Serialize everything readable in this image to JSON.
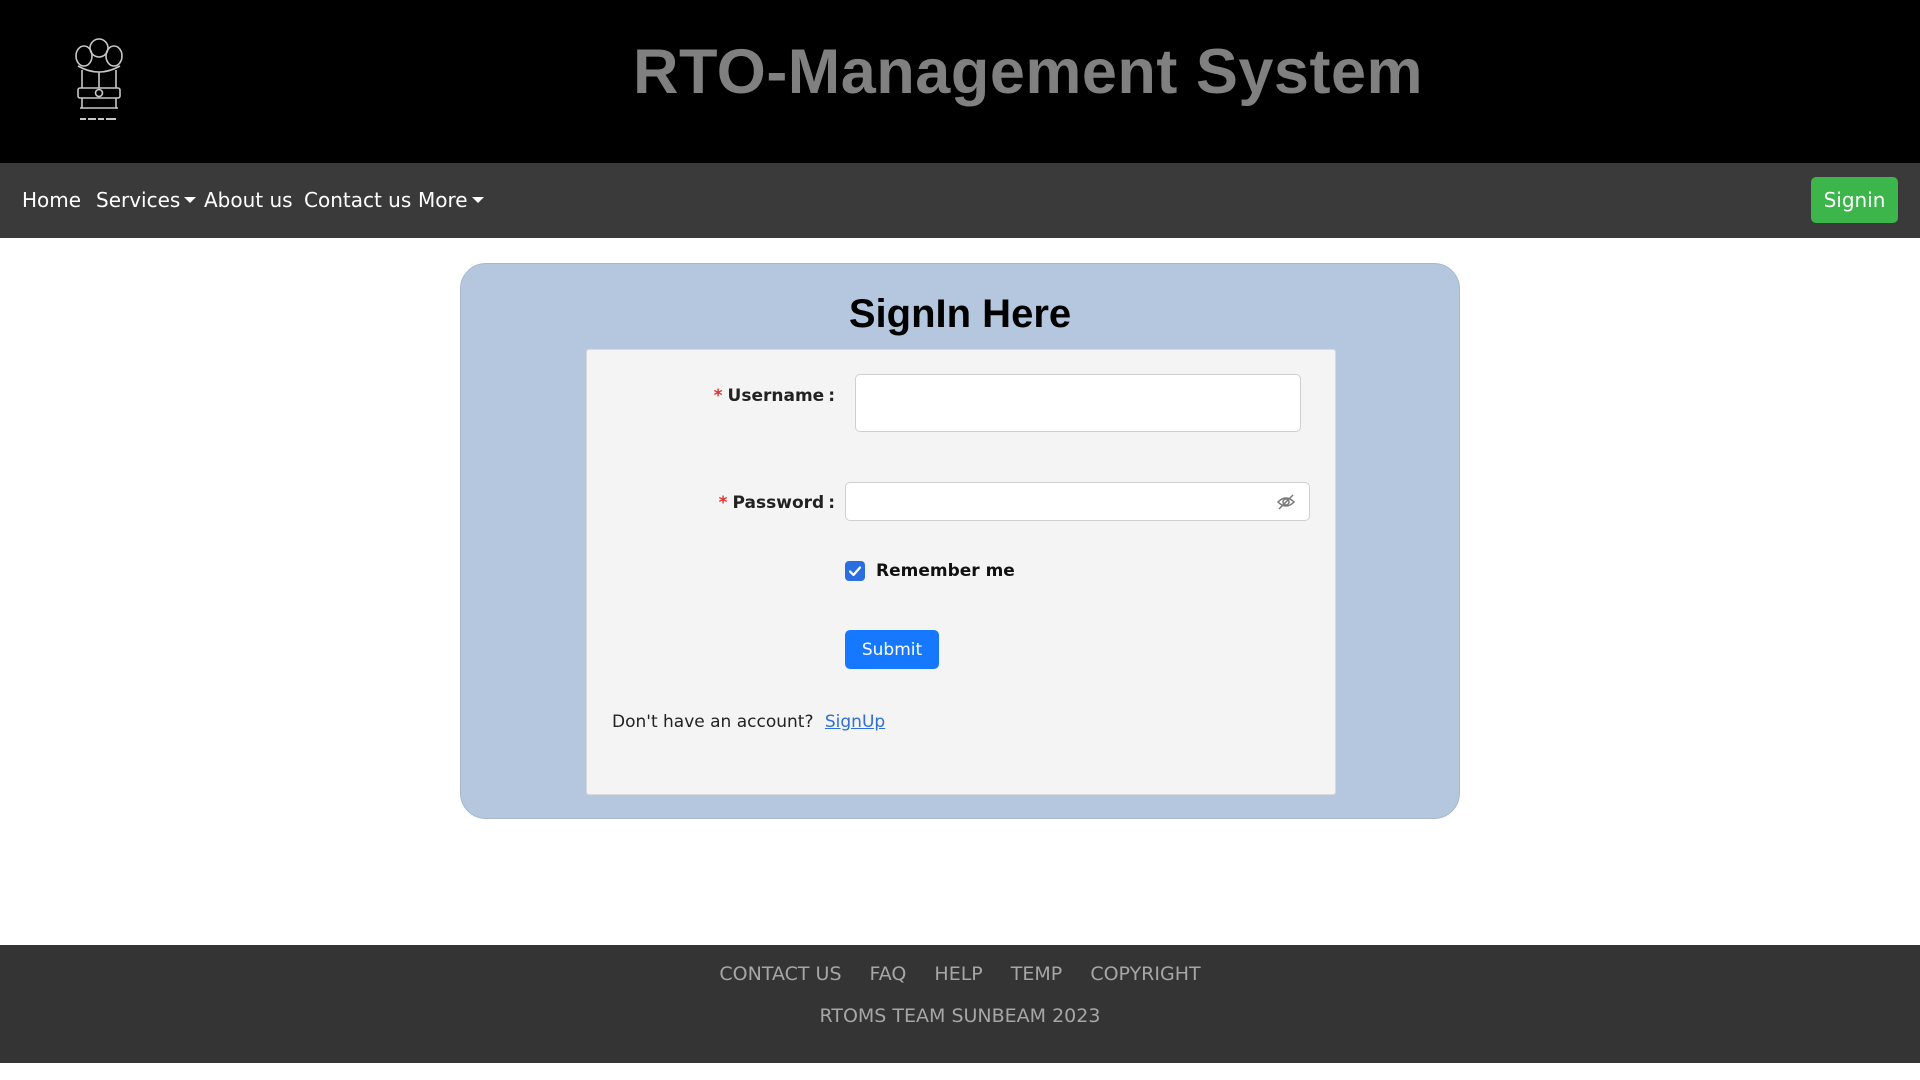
{
  "header": {
    "logo_icon": "national-emblem-icon",
    "title": "RTO-Management System"
  },
  "navbar": {
    "items": [
      {
        "label": "Home",
        "dropdown": false
      },
      {
        "label": "Services",
        "dropdown": true
      },
      {
        "label": "About us",
        "dropdown": false
      },
      {
        "label": "Contact us",
        "dropdown": false
      },
      {
        "label": "More",
        "dropdown": true
      }
    ],
    "signin_label": "Signin",
    "signin_color": "#3cb54a"
  },
  "signin_form": {
    "title": "SignIn Here",
    "username_label": "Username",
    "username_value": "",
    "password_label": "Password",
    "password_value": "",
    "password_toggle_icon": "eye-slash-icon",
    "remember_label": "Remember me",
    "remember_checked": true,
    "submit_label": "Submit",
    "no_account_text": "Don't have an account?",
    "signup_link": "SignUp",
    "card_color": "#b4c7de",
    "accent_color": "#1677ff"
  },
  "footer": {
    "links": [
      "CONTACT US",
      "FAQ",
      "HELP",
      "TEMP",
      "COPYRIGHT"
    ],
    "copyright": "RTOMS TEAM SUNBEAM 2023"
  }
}
